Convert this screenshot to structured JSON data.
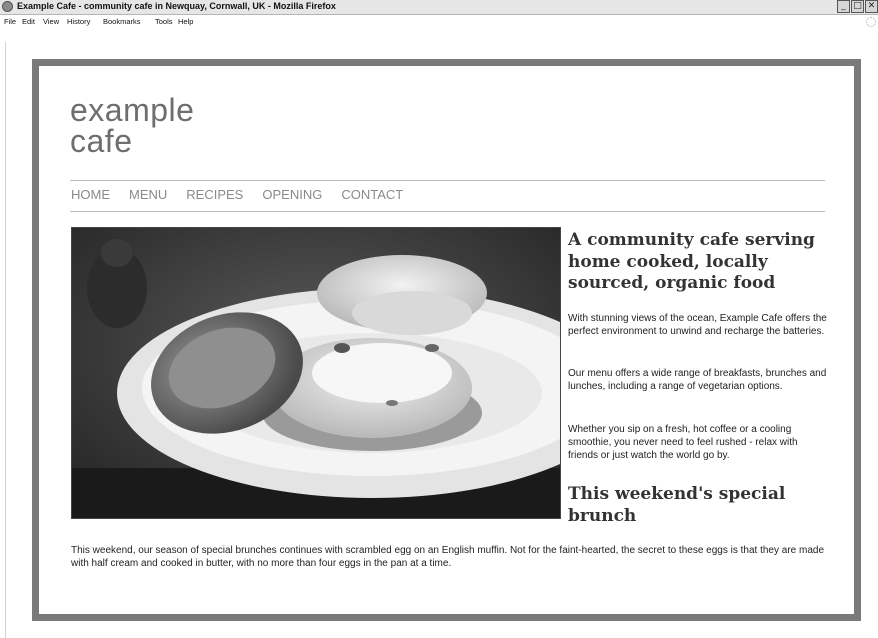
{
  "window": {
    "title": "Example Cafe - community cafe in Newquay, Cornwall, UK - Mozilla Firefox",
    "buttons": {
      "minimize": "_",
      "maximize": "□",
      "close": "✕"
    }
  },
  "menubar": [
    "File",
    "Edit",
    "View",
    "History",
    "Bookmarks",
    "Tools",
    "Help"
  ],
  "site": {
    "logo_line1": "example",
    "logo_line2": "cafe",
    "nav": [
      "HOME",
      "MENU",
      "RECIPES",
      "OPENING",
      "CONTACT"
    ],
    "heading": "A community cafe serving home cooked, locally sourced, organic food",
    "paragraphs": [
      "With stunning views of the ocean, Example Cafe offers the perfect environment to unwind and recharge the batteries.",
      "Our menu offers a wide range of breakfasts, brunches and lunches, including a range of vegetarian options.",
      "Whether you sip on a fresh, hot coffee or a cooling smoothie, you never need to feel rushed - relax with friends or just watch the world go by."
    ],
    "special_heading": "This weekend's special brunch",
    "special_text": "This weekend, our season of special brunches continues with scrambled egg on an English muffin. Not for the faint-hearted, the secret to these eggs is that they are made with half cream and cooked in butter, with no more than four eggs in the pan at a time."
  }
}
